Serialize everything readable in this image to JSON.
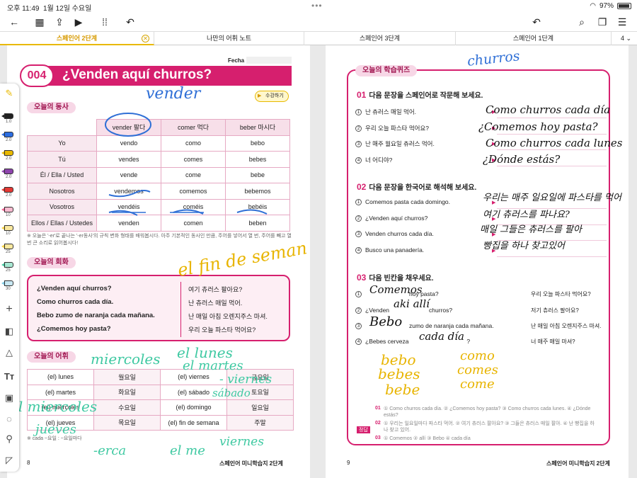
{
  "status": {
    "time": "오후 11:49",
    "date": "1월 12일 수요일",
    "battery": "97%"
  },
  "tabs": [
    {
      "label": "스페인어 2단계",
      "active": true
    },
    {
      "label": "나만의 어휘 노트"
    },
    {
      "label": "스페인어 3단계"
    },
    {
      "label": "스페인어 1단계"
    }
  ],
  "tab_count": "4",
  "pen_sizes": [
    "1.0",
    "2.0",
    "2.0",
    "2.0",
    "2.0",
    "10",
    "10",
    "25",
    "25",
    "30"
  ],
  "pen_colors": [
    "#222222",
    "#2b6de0",
    "#e8b900",
    "#8e44ad",
    "#e53935",
    "#f06292",
    "#f4d03f",
    "#f4d03f",
    "#46c9a0",
    "#7ec8e3"
  ],
  "left": {
    "fecha": "Fecha :",
    "lesson_num": "004",
    "title": "¿Venden aquí churros?",
    "listen": "수강하기",
    "verbs_badge": "오늘의 동사",
    "verb_headers": [
      "vender 팔다",
      "comer 먹다",
      "beber 마시다"
    ],
    "verb_rows": [
      {
        "subj": "Yo",
        "v": [
          "vendo",
          "como",
          "bebo"
        ]
      },
      {
        "subj": "Tú",
        "v": [
          "vendes",
          "comes",
          "bebes"
        ]
      },
      {
        "subj": "Él / Ella / Usted",
        "v": [
          "vende",
          "come",
          "bebe"
        ]
      },
      {
        "subj": "Nosotros",
        "v": [
          "vendemos",
          "comemos",
          "bebemos"
        ]
      },
      {
        "subj": "Vosotros",
        "v": [
          "vendéis",
          "coméis",
          "bebéis"
        ]
      },
      {
        "subj": "Ellos / Ellas / Ustedes",
        "v": [
          "venden",
          "comen",
          "beben"
        ]
      }
    ],
    "verb_note": "※ 오늘은 '-er'로 끝나는 '-er동사'의 규칙 변화 형태를 배워봅시다. 아주 기본적인 동사인 만큼, 주어를 넣어서 열 번, 주어를 빼고 열 번 큰 소리로 읽어봅시다!",
    "conv_badge": "오늘의 회화",
    "conv": [
      {
        "es": "¿Venden aquí churros?",
        "ko": "여기 츄러스 팔아요?"
      },
      {
        "es": "Como churros cada día.",
        "ko": "난 츄러스 매일 먹어."
      },
      {
        "es": "Bebo zumo de naranja cada mañana.",
        "ko": "난 매일 아침 오렌지주스 마셔."
      },
      {
        "es": "¿Comemos hoy pasta?",
        "ko": "우리 오늘 파스타 먹어요?"
      }
    ],
    "vocab_badge": "오늘의 어휘",
    "vocab": [
      [
        "(el) lunes",
        "월요일",
        "(el) viernes",
        "금요일"
      ],
      [
        "(el) martes",
        "화요일",
        "(el) sábado",
        "토요일"
      ],
      [
        "(el) miércoles",
        "수요일",
        "(el) domingo",
        "일요일"
      ],
      [
        "(el) jueves",
        "목요일",
        "(el) fin de semana",
        "주말"
      ]
    ],
    "vocab_note": "※ cada ~요일 : ~요일마다",
    "page_num": "8",
    "brand": "스페인어 미니학습지 2단계"
  },
  "right": {
    "quiz_badge": "오늘의 학습퀴즈",
    "s1_num": "01",
    "s1": "다음 문장을 스페인어로 작문해 보세요.",
    "s1_q": [
      "난 츄러스 매일 먹어.",
      "우리 오늘 파스타 먹어요?",
      "난 매주 월요일 츄러스 먹어.",
      "너 어디야?"
    ],
    "s2_num": "02",
    "s2": "다음 문장을 한국어로 해석해 보세요.",
    "s2_q": [
      "Comemos pasta cada domingo.",
      "¿Venden aquí churros?",
      "Venden churros cada día.",
      "Busco una panadería."
    ],
    "s3_num": "03",
    "s3": "다음 빈칸을 채우세요.",
    "s3_q": [
      {
        "a": "",
        "b": "hoy pasta?",
        "t": "우리 오늘 파스타 먹어요?"
      },
      {
        "a": "¿Venden",
        "b": "churros?",
        "t": "저기 츄러스 팔아요?"
      },
      {
        "a": "",
        "b": "zumo de naranja cada mañana.",
        "t": "난 매일 아침 오렌지주스 마셔."
      },
      {
        "a": "¿Bebes cerveza",
        "b": "?",
        "t": "너 매주 매일 마셔?"
      }
    ],
    "answer_label": "정답",
    "answers": [
      {
        "n": "01",
        "t": "① Como churros cada día. ② ¿Comemos hoy pasta? ③ Como churros cada lunes. ④ ¿Dónde estás?"
      },
      {
        "n": "02",
        "t": "① 우리는 일요일마다 파스타 먹어. ② 여기 츄러스 팔아요? ③ 그들은 츄러스 매일 팔아. ④ 난 빵집을 하나 찾고 있어."
      },
      {
        "n": "03",
        "t": "① Comemos ② allí ③ Bebo ④ cada día"
      }
    ],
    "page_num": "9",
    "brand": "스페인어 미니학습지 2단계"
  },
  "ink": {
    "vender": "vender",
    "fin": "el fin de seman",
    "miercoles": "miercoles",
    "lunes": "el lunes",
    "martes": "el martes",
    "viernes": "- viernes",
    "sabado": "sábado",
    "jueves": "jueves",
    "miercoles2": "el miercoles",
    "erca": "-erca",
    "elme": "el me",
    "viernes2": "viernes",
    "churros": "churros",
    "a1": "Como churros cada día",
    "a2": "¿Comemos hoy pasta?",
    "a3": "Como churros cada lunes",
    "a4": "¿Dónde estás?",
    "k1": "우리는 매주 일요일에 파스타를 먹어",
    "k2": "여기 츄러스를 파나요?",
    "k3": "매일 그들은 츄러스를 팔아",
    "k4": "빵집을 하나 찾고있어",
    "f1": "Comemos",
    "f2": "aki allí",
    "f3": "Bebo",
    "f4": "cada día",
    "bebo": "bebo",
    "bebes": "bebes",
    "bebe": "bebe",
    "como": "como",
    "comes": "comes",
    "come": "come"
  }
}
